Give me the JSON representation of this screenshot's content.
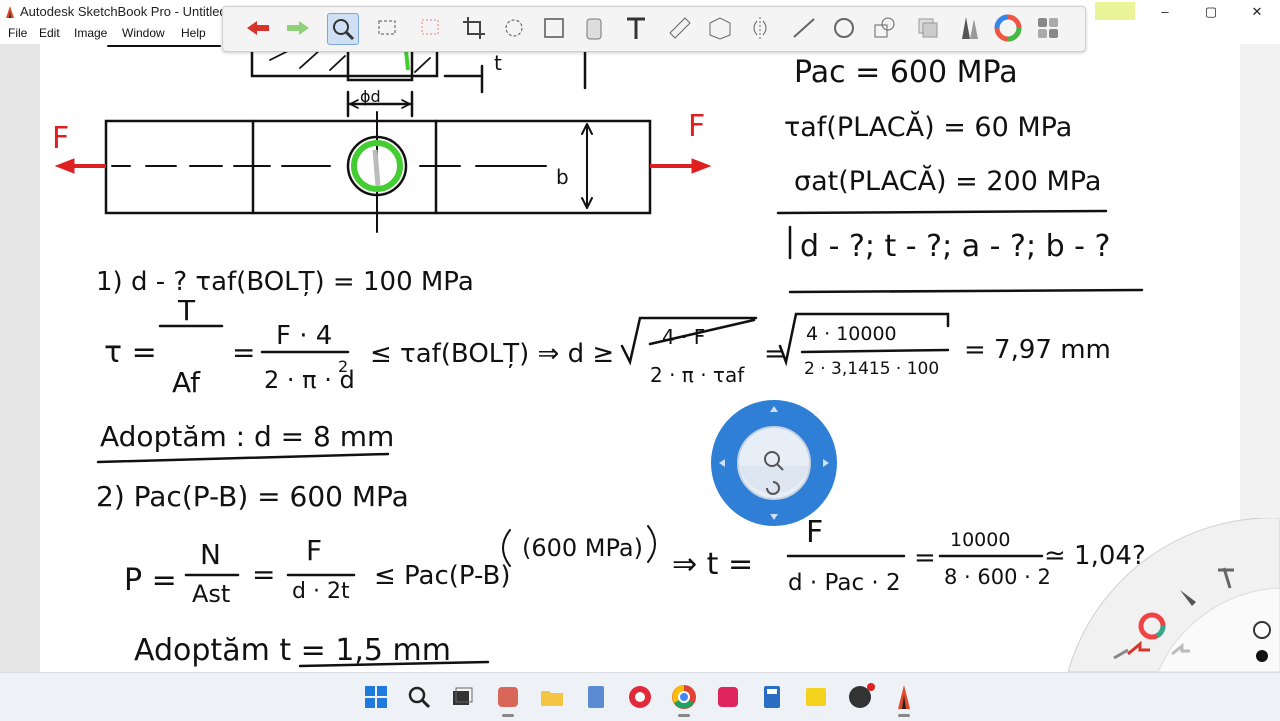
{
  "app": {
    "title": "Autodesk SketchBook Pro - Untitled @",
    "window_controls": [
      "–",
      "▢",
      "✕"
    ]
  },
  "menu": {
    "items": [
      "File",
      "Edit",
      "Image",
      "Window",
      "Help"
    ]
  },
  "toolbar": {
    "tools": [
      "undo-icon",
      "redo-icon",
      "zoom-icon",
      "select-rect-icon",
      "select-lasso-icon",
      "crop-icon",
      "transform-icon",
      "distort-icon",
      "fill-icon",
      "text-icon",
      "ruler-icon",
      "perspective-icon",
      "symmetry-icon",
      "stroke-icon",
      "ellipse-icon",
      "shapes-icon",
      "layers-icon",
      "brushes-icon",
      "color-wheel-icon",
      "palette-icon"
    ],
    "active": "zoom-icon"
  },
  "notes": {
    "given": [
      "Pac = 600 MPa",
      "τaf(PLACĂ) = 60 MPa",
      "σat(PLACĂ) = 200 MPa"
    ],
    "unknowns": "d - ?; t - ?; a - ?; b - ?",
    "force_left": "F",
    "force_right": "F",
    "dim_top": "t",
    "dim_d": "ϕd",
    "dim_b": "b",
    "step1_title": "1) d - ?   τaf(BOLȚ) = 100 MPa",
    "step1_t": "τ =",
    "step1_num1": "T",
    "step1_den1": "Af",
    "step1_eq": "=",
    "step1_num2": "F · 4",
    "step1_den2": "2 · π · d",
    "step1_exp": "2",
    "step1_rel": "≤ τaf(BOLȚ) ⇒ d ≥",
    "step1_num3": "4 · F",
    "step1_den3": "2 · π · τaf",
    "step1_num4": "4 · 10000",
    "step1_den4": "2 · 3,1415 · 100",
    "step1_result": "= 7,97 mm",
    "adopt1": "Adoptăm :   d = 8 mm",
    "step2_title": "2) Pac(P-B) = 600 MPa",
    "step2_p": "P =",
    "step2_num1": "N",
    "step2_den1": "Ast",
    "step2_num2": "F",
    "step2_den2": "d · 2t",
    "step2_rel": "≤ Pac(P-B)",
    "step2_paren": "(600 MPa)",
    "step2_impl": "⇒ t =",
    "step2_num3": "F",
    "step2_den3": "d · Pac · 2",
    "step2_num4": "10000",
    "step2_den4": "8 · 600 · 2",
    "step2_result": "≃ 1,04?",
    "adopt2": "Adoptăm  t = 1,5 mm"
  },
  "zoom_puck": {
    "icon": "magnifier-icon",
    "close": "×"
  },
  "colors": {
    "ink": "#111111",
    "force": "#e02020",
    "bolt_green": "#44cc33",
    "puck_blue": "#2f7fd6",
    "undo_red": "#d9342b"
  }
}
